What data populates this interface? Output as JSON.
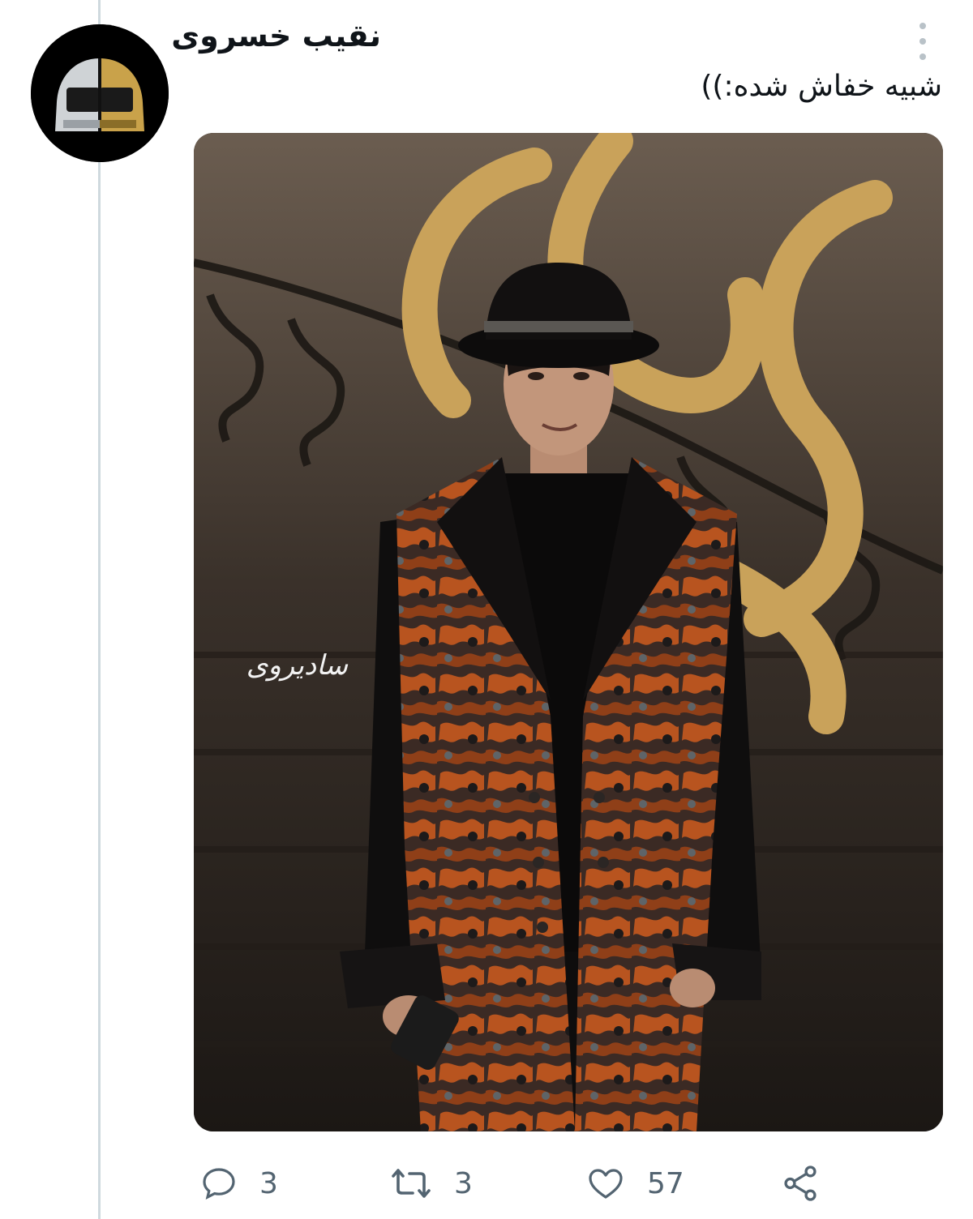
{
  "tweet": {
    "author": {
      "name": "نقیب خسروی"
    },
    "text": "شبیه خفاش شده:))",
    "media": {
      "watermark": "سادیروی"
    },
    "actions": {
      "reply": {
        "icon": "reply-icon",
        "count": "3"
      },
      "retweet": {
        "icon": "retweet-icon",
        "count": "3"
      },
      "like": {
        "icon": "heart-icon",
        "count": "57"
      },
      "share": {
        "icon": "share-icon"
      }
    }
  },
  "colors": {
    "text": "#0f1419",
    "muted": "#536471",
    "thread_line": "#cfd9de",
    "gold": "#c9a25a"
  }
}
